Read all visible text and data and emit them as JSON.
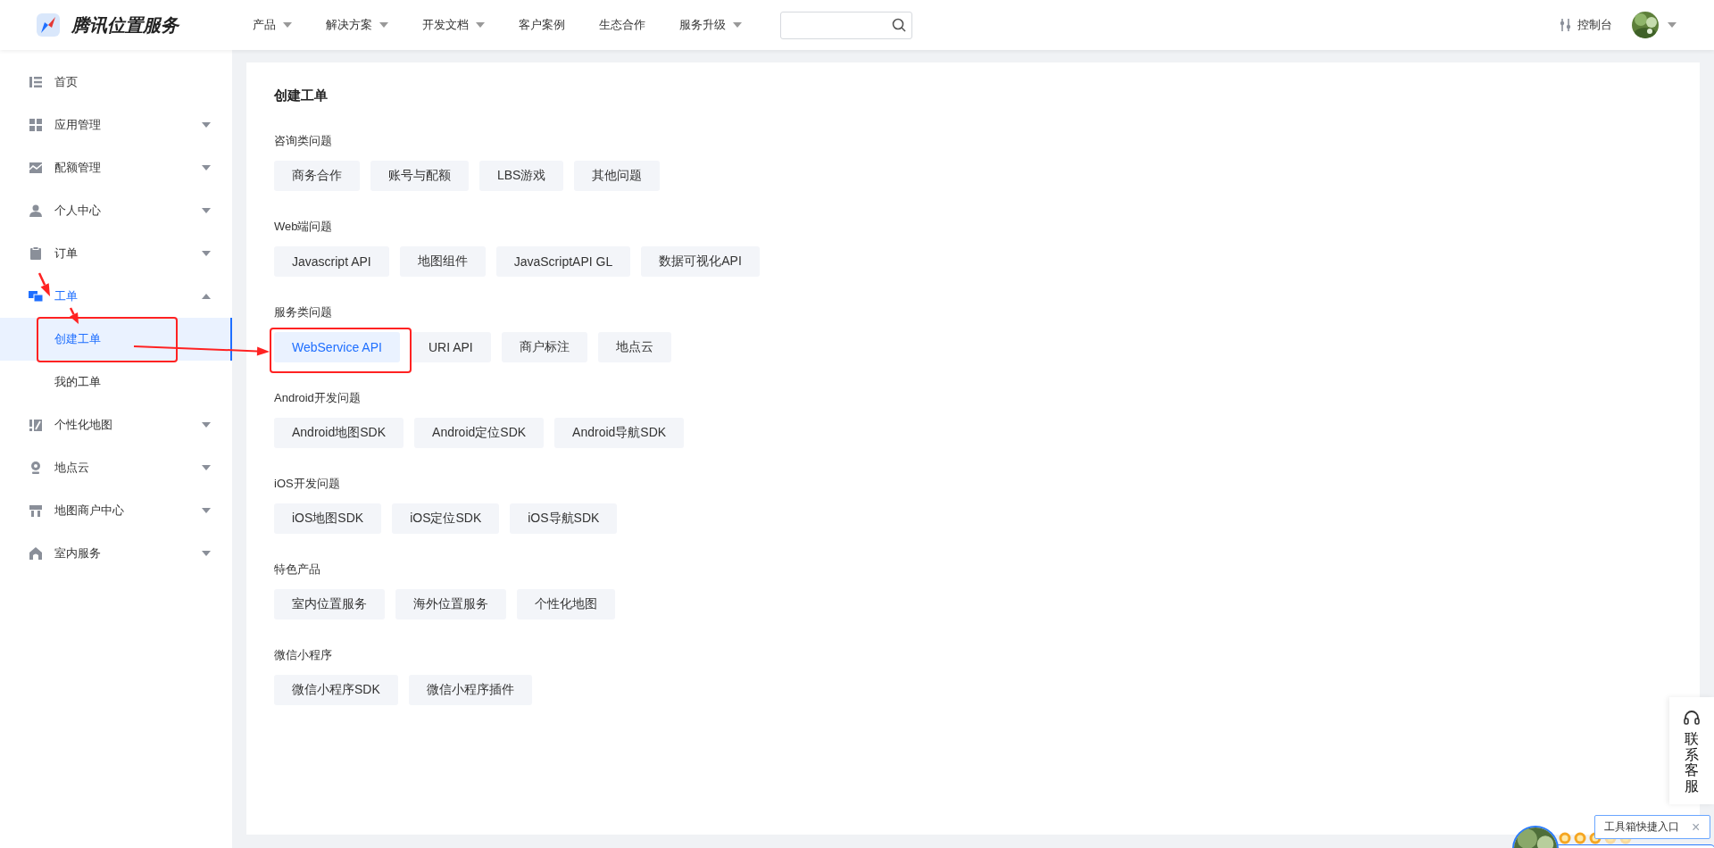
{
  "header": {
    "logo_text": "腾讯位置服务",
    "nav": [
      {
        "label": "产品",
        "dropdown": true
      },
      {
        "label": "解决方案",
        "dropdown": true
      },
      {
        "label": "开发文档",
        "dropdown": true
      },
      {
        "label": "客户案例",
        "dropdown": false
      },
      {
        "label": "生态合作",
        "dropdown": false
      },
      {
        "label": "服务升级",
        "dropdown": true
      }
    ],
    "console": "控制台"
  },
  "sidebar": {
    "items": [
      {
        "label": "首页",
        "kind": "link",
        "selected": false
      },
      {
        "label": "应用管理",
        "kind": "group",
        "expanded": false,
        "selected": false
      },
      {
        "label": "配额管理",
        "kind": "group",
        "expanded": false,
        "selected": false
      },
      {
        "label": "个人中心",
        "kind": "group",
        "expanded": false,
        "selected": false
      },
      {
        "label": "订单",
        "kind": "group",
        "expanded": false,
        "selected": false
      },
      {
        "label": "工单",
        "kind": "group",
        "expanded": true,
        "selected": true,
        "children": [
          {
            "label": "创建工单",
            "selected": true
          },
          {
            "label": "我的工单",
            "selected": false
          }
        ]
      },
      {
        "label": "个性化地图",
        "kind": "group",
        "expanded": false,
        "selected": false
      },
      {
        "label": "地点云",
        "kind": "group",
        "expanded": false,
        "selected": false
      },
      {
        "label": "地图商户中心",
        "kind": "group",
        "expanded": false,
        "selected": false
      },
      {
        "label": "室内服务",
        "kind": "group",
        "expanded": false,
        "selected": false
      }
    ]
  },
  "content": {
    "title": "创建工单",
    "sections": [
      {
        "label": "咨询类问题",
        "buttons": [
          {
            "label": "商务合作",
            "selected": false
          },
          {
            "label": "账号与配额",
            "selected": false
          },
          {
            "label": "LBS游戏",
            "selected": false
          },
          {
            "label": "其他问题",
            "selected": false
          }
        ]
      },
      {
        "label": "Web端问题",
        "buttons": [
          {
            "label": "Javascript API",
            "selected": false
          },
          {
            "label": "地图组件",
            "selected": false
          },
          {
            "label": "JavaScriptAPI GL",
            "selected": false
          },
          {
            "label": "数据可视化API",
            "selected": false
          }
        ]
      },
      {
        "label": "服务类问题",
        "buttons": [
          {
            "label": "WebService API",
            "selected": true
          },
          {
            "label": "URI API",
            "selected": false
          },
          {
            "label": "商户标注",
            "selected": false
          },
          {
            "label": "地点云",
            "selected": false
          }
        ]
      },
      {
        "label": "Android开发问题",
        "buttons": [
          {
            "label": "Android地图SDK",
            "selected": false
          },
          {
            "label": "Android定位SDK",
            "selected": false
          },
          {
            "label": "Android导航SDK",
            "selected": false
          }
        ]
      },
      {
        "label": "iOS开发问题",
        "buttons": [
          {
            "label": "iOS地图SDK",
            "selected": false
          },
          {
            "label": "iOS定位SDK",
            "selected": false
          },
          {
            "label": "iOS导航SDK",
            "selected": false
          }
        ]
      },
      {
        "label": "特色产品",
        "buttons": [
          {
            "label": "室内位置服务",
            "selected": false
          },
          {
            "label": "海外位置服务",
            "selected": false
          },
          {
            "label": "个性化地图",
            "selected": false
          }
        ]
      },
      {
        "label": "微信小程序",
        "buttons": [
          {
            "label": "微信小程序SDK",
            "selected": false
          },
          {
            "label": "微信小程序插件",
            "selected": false
          }
        ]
      }
    ]
  },
  "support": {
    "label": "联系客服"
  },
  "toolbox": {
    "tooltip": "工具箱快捷入口",
    "close": "×"
  }
}
